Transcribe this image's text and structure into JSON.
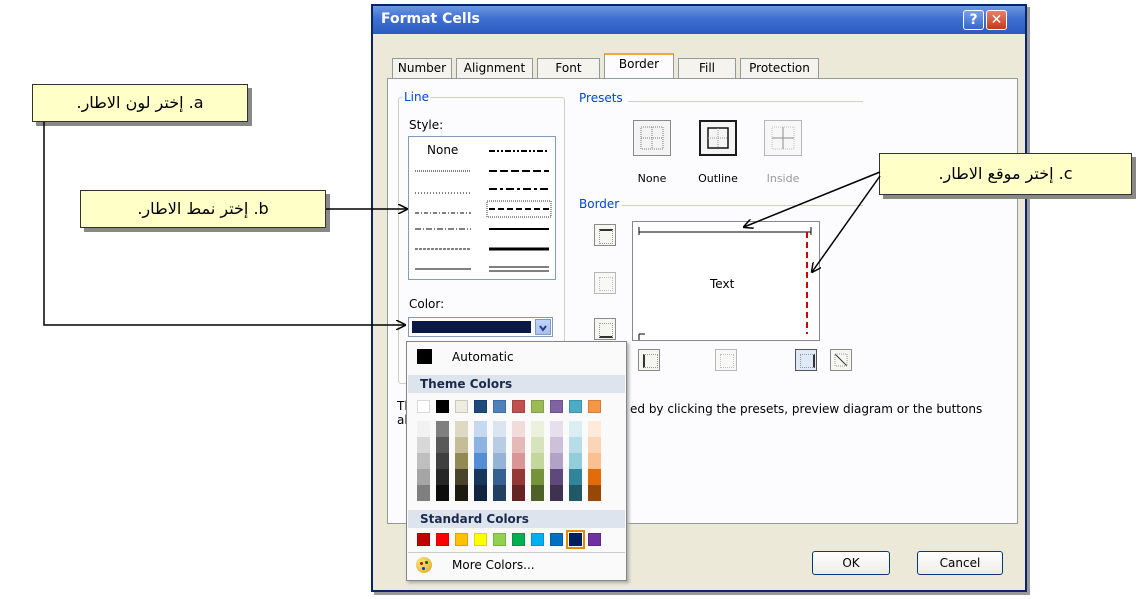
{
  "dialog": {
    "title": "Format Cells",
    "help_glyph": "?",
    "close_glyph": "✕"
  },
  "tabs": [
    "Number",
    "Alignment",
    "Font",
    "Border",
    "Fill",
    "Protection"
  ],
  "active_tab": "Border",
  "line_group": {
    "label": "Line",
    "style_label": "Style:",
    "none_label": "None",
    "color_label": "Color:",
    "color_value": "#0a1a44"
  },
  "presets": {
    "label": "Presets",
    "items": [
      "None",
      "Outline",
      "Inside"
    ]
  },
  "border_group": {
    "label": "Border",
    "preview_text": "Text"
  },
  "hint_text": {
    "left_fragment_1": "Th",
    "left_fragment_2": "ab",
    "right_fragment": "ed by clicking the presets, preview diagram or the buttons"
  },
  "buttons": {
    "ok": "OK",
    "cancel": "Cancel"
  },
  "color_menu": {
    "automatic": "Automatic",
    "theme_colors": "Theme Colors",
    "standard_colors": "Standard Colors",
    "more_colors": "More Colors...",
    "theme_top": [
      "#ffffff",
      "#000000",
      "#eeece1",
      "#1f497d",
      "#4f81bd",
      "#c0504d",
      "#9bbb59",
      "#8064a2",
      "#4bacc6",
      "#f79646"
    ],
    "theme_shades": [
      [
        "#f2f2f2",
        "#7f7f7f",
        "#ddd9c3",
        "#c6d9f0",
        "#dbe5f1",
        "#f2dcdb",
        "#ebf1dd",
        "#e5e0ec",
        "#dbeef3",
        "#fdeada"
      ],
      [
        "#d8d8d8",
        "#595959",
        "#c4bd97",
        "#8db3e2",
        "#b8cce4",
        "#e5b9b7",
        "#d7e3bc",
        "#ccc1d9",
        "#b7dde8",
        "#fbd5b5"
      ],
      [
        "#bfbfbf",
        "#3f3f3f",
        "#938953",
        "#548dd4",
        "#95b3d7",
        "#d99694",
        "#c3d69b",
        "#b2a2c7",
        "#92cddc",
        "#fac08f"
      ],
      [
        "#a5a5a5",
        "#262626",
        "#494429",
        "#17365d",
        "#366092",
        "#953734",
        "#76923c",
        "#5f497a",
        "#31859b",
        "#e36c09"
      ],
      [
        "#7f7f7f",
        "#0c0c0c",
        "#1d1b10",
        "#0f243e",
        "#244061",
        "#632423",
        "#4f6128",
        "#3f3151",
        "#205867",
        "#974806"
      ]
    ],
    "standard": [
      "#c00000",
      "#ff0000",
      "#ffc000",
      "#ffff00",
      "#92d050",
      "#00b050",
      "#00b0f0",
      "#0070c0",
      "#002060",
      "#7030a0"
    ]
  },
  "callouts": {
    "a": "a. إختر لون الاطار.",
    "b": "b. إختر نمط الاطار.",
    "c": "c. إختر موقع الاطار."
  },
  "colors": {
    "title_bar": "#3e6fd1",
    "callout_bg": "#ffffc8",
    "accent_red": "#cc0000"
  }
}
